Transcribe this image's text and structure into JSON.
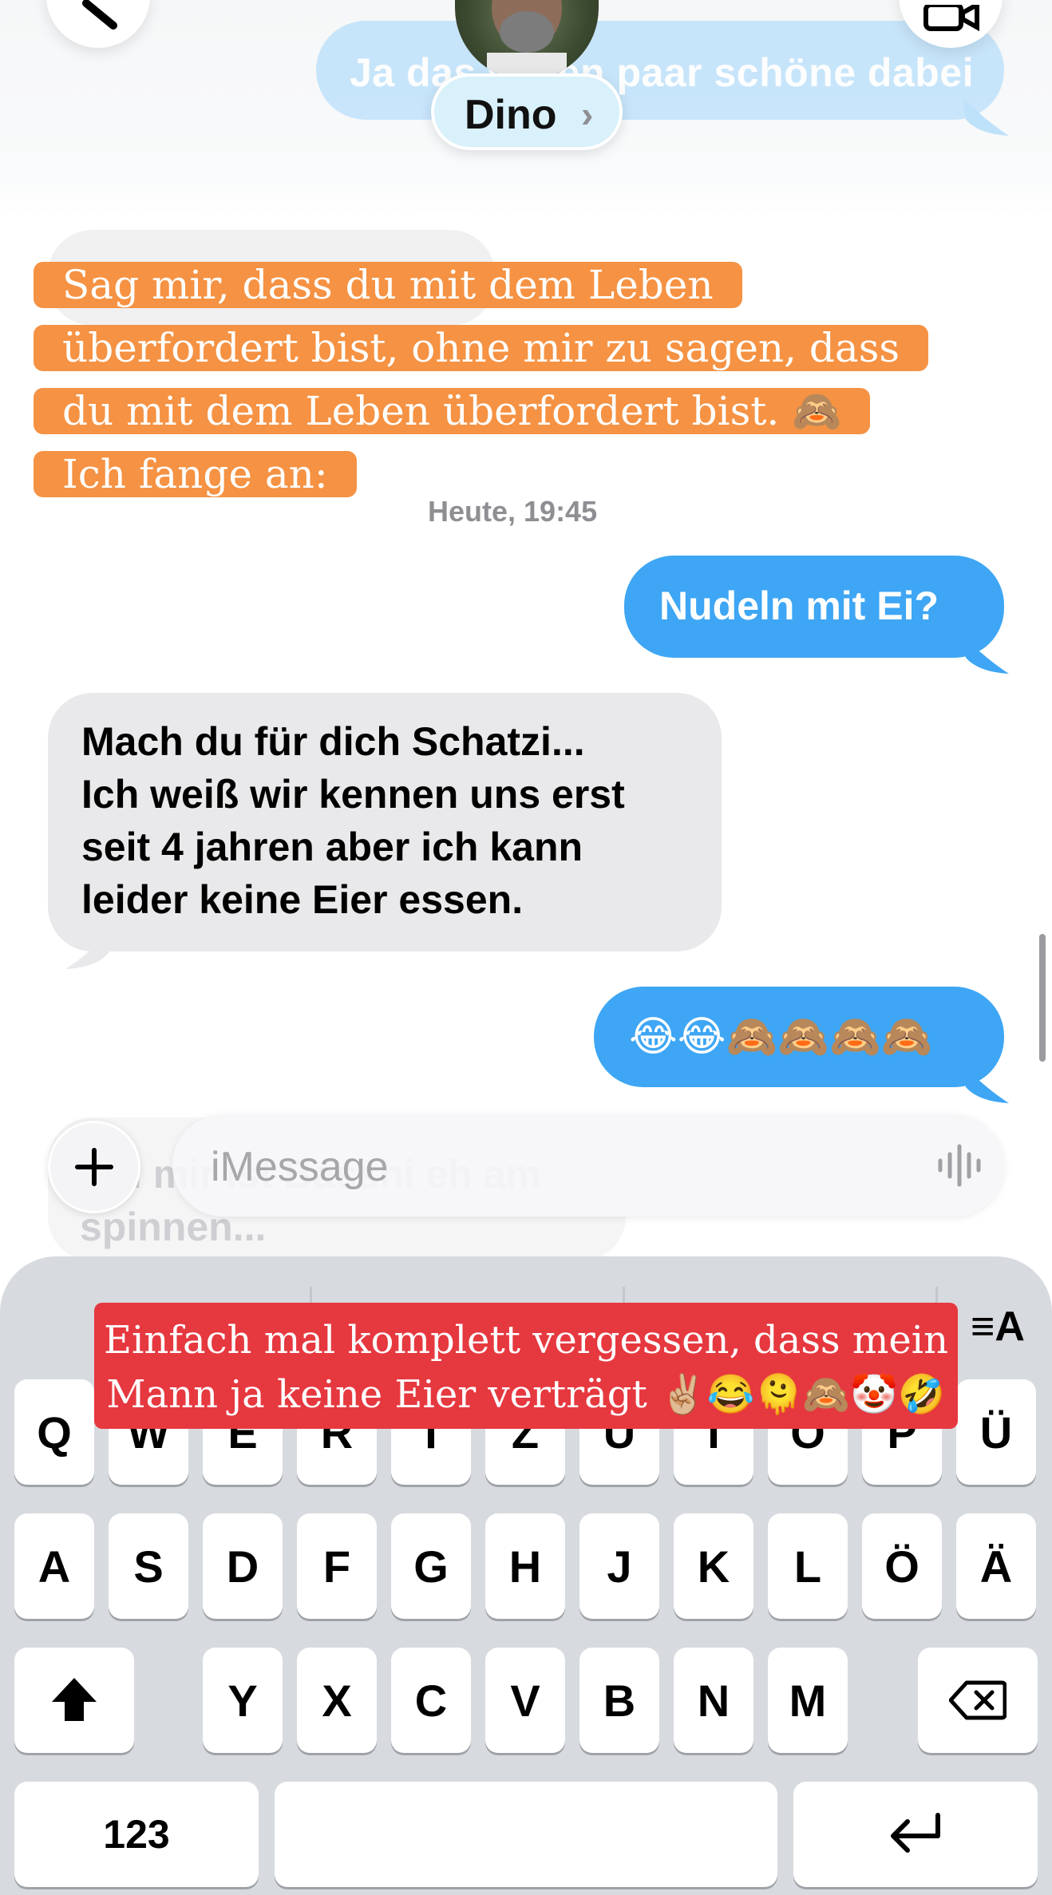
{
  "header": {
    "contact_name": "Dino",
    "contact_chevron": "›",
    "prev_sent_message": "Ja das waren paar schöne dabei"
  },
  "overlay_top": {
    "line1": "Sag mir, dass du mit dem Leben",
    "line2": "überfordert bist, ohne mir zu sagen, dass",
    "line3": "du mit dem Leben überfordert bist. 🙈",
    "line4": "Ich fange an:"
  },
  "timestamp": "Heute, 19:45",
  "messages": {
    "sent_1": "Nudeln mit Ei?",
    "received_1": [
      "Mach du für dich Schatzi...",
      "Ich weiß wir kennen uns erst",
      "seit 4 jahren aber ich kann",
      "leider keine Eier essen."
    ],
    "sent_2": "😂😂🙈🙈🙈🙈",
    "received_2_partial": [
      "Bei mir ist Basshi eh am",
      "spinnen..."
    ]
  },
  "input": {
    "placeholder": "iMessage",
    "plus_label": "+"
  },
  "overlay_bottom": {
    "line1": "Einfach mal komplett vergessen, dass mein",
    "line2": "Mann ja keine Eier verträgt ✌🏼😂🫠🙈🤡🤣"
  },
  "keyboard": {
    "row1": [
      "Q",
      "W",
      "E",
      "R",
      "T",
      "Z",
      "U",
      "I",
      "O",
      "P",
      "Ü"
    ],
    "row2": [
      "A",
      "S",
      "D",
      "F",
      "G",
      "H",
      "J",
      "K",
      "L",
      "Ö",
      "Ä"
    ],
    "row3": [
      "Y",
      "X",
      "C",
      "V",
      "B",
      "N",
      "M"
    ],
    "numbers_label": "123",
    "format_icon_label": "≡A"
  },
  "colors": {
    "sent_bubble": "#3ea6f4",
    "received_bubble": "#e9e9eb",
    "overlay_orange": "#f59243",
    "overlay_red": "#e6383f",
    "keyboard_bg": "#d7dade"
  }
}
